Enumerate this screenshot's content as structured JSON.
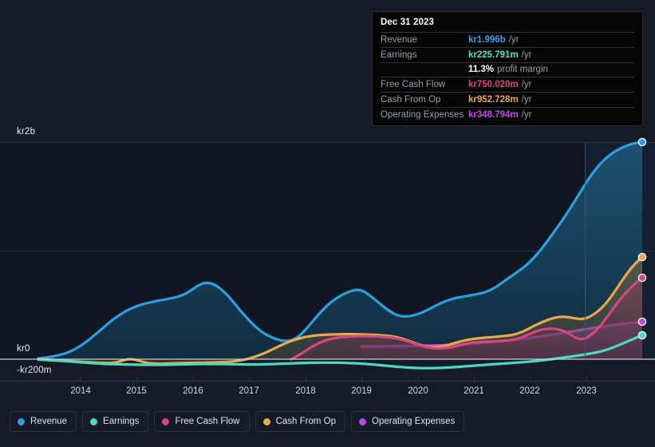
{
  "tooltip": {
    "date": "Dec 31 2023",
    "rows": [
      {
        "label": "Revenue",
        "value": "kr1.996b",
        "unit": "/yr",
        "color": "#3ba3e8"
      },
      {
        "label": "Earnings",
        "value": "kr225.791m",
        "unit": "/yr",
        "color": "#4fe3c8"
      },
      {
        "label": "",
        "value": "11.3%",
        "unit": "profit margin",
        "color": "#ffffff"
      },
      {
        "label": "Free Cash Flow",
        "value": "kr750.020m",
        "unit": "/yr",
        "color": "#e0477f"
      },
      {
        "label": "Cash From Op",
        "value": "kr952.728m",
        "unit": "/yr",
        "color": "#e9a94a"
      },
      {
        "label": "Operating Expenses",
        "value": "kr348.794m",
        "unit": "/yr",
        "color": "#c44ae8"
      }
    ]
  },
  "legend": [
    {
      "label": "Revenue",
      "color": "#2e9fe0"
    },
    {
      "label": "Earnings",
      "color": "#4fd8c0"
    },
    {
      "label": "Free Cash Flow",
      "color": "#d6487e"
    },
    {
      "label": "Cash From Op",
      "color": "#e8a84c"
    },
    {
      "label": "Operating Expenses",
      "color": "#b94ae8"
    }
  ],
  "axes": {
    "y_labels": [
      "kr2b",
      "kr0",
      "-kr200m"
    ],
    "x_labels": [
      "2014",
      "2015",
      "2016",
      "2017",
      "2018",
      "2019",
      "2020",
      "2021",
      "2022",
      "2023"
    ]
  },
  "chart_data": {
    "type": "area",
    "title": "",
    "xlabel": "",
    "ylabel": "",
    "currency": "kr",
    "ylim": [
      -200000000,
      2000000000
    ],
    "yticks": [
      2000000000,
      0,
      -200000000
    ],
    "ytick_labels": [
      "kr2b",
      "kr0",
      "-kr200m"
    ],
    "gridlines": [
      2000000000,
      1000000000,
      0
    ],
    "xlim": [
      "2013-06",
      "2023-12"
    ],
    "xticks": [
      "2014",
      "2015",
      "2016",
      "2017",
      "2018",
      "2019",
      "2020",
      "2021",
      "2022",
      "2023"
    ],
    "legend_position": "bottom",
    "highlight_band_from": "2022-10",
    "series": [
      {
        "name": "Revenue",
        "color": "#2e9fe0",
        "fill": "#16394f",
        "x": [
          "2013-06",
          "2013-12",
          "2014-06",
          "2014-12",
          "2015-06",
          "2015-12",
          "2016-03",
          "2016-06",
          "2016-12",
          "2017-06",
          "2017-12",
          "2018-03",
          "2018-06",
          "2018-12",
          "2019-03",
          "2019-06",
          "2019-12",
          "2020-06",
          "2020-12",
          "2021-06",
          "2021-12",
          "2022-06",
          "2022-12",
          "2023-06",
          "2023-12"
        ],
        "values": [
          8000000,
          20000000,
          80000000,
          300000000,
          480000000,
          620000000,
          700000000,
          680000000,
          560000000,
          420000000,
          400000000,
          460000000,
          560000000,
          640000000,
          700000000,
          660000000,
          620000000,
          560000000,
          640000000,
          700000000,
          760000000,
          980000000,
          1300000000,
          1700000000,
          1996000000
        ]
      },
      {
        "name": "Earnings",
        "color": "#4fd8c0",
        "fill": "#1d4a47",
        "x": [
          "2013-06",
          "2014-06",
          "2015-06",
          "2016-06",
          "2017-06",
          "2018-06",
          "2019-06",
          "2020-06",
          "2021-06",
          "2022-06",
          "2023-06",
          "2023-12"
        ],
        "values": [
          -6000000,
          -20000000,
          -30000000,
          -26000000,
          -30000000,
          -24000000,
          -30000000,
          -40000000,
          -10000000,
          40000000,
          140000000,
          225791000
        ]
      },
      {
        "name": "Free Cash Flow",
        "color": "#d6487e",
        "fill": "#4a2b3b",
        "x": [
          "2017-12",
          "2018-06",
          "2018-12",
          "2019-06",
          "2019-12",
          "2020-06",
          "2020-12",
          "2021-06",
          "2021-12",
          "2022-06",
          "2022-12",
          "2023-06",
          "2023-12"
        ],
        "values": [
          -4000000,
          60000000,
          140000000,
          150000000,
          150000000,
          140000000,
          120000000,
          90000000,
          180000000,
          190000000,
          120000000,
          420000000,
          750020000
        ]
      },
      {
        "name": "Cash From Op",
        "color": "#e8a84c",
        "fill": "#4d4332",
        "x": [
          "2013-06",
          "2014-06",
          "2015-06",
          "2016-03",
          "2016-09",
          "2017-06",
          "2018-06",
          "2018-12",
          "2019-06",
          "2019-12",
          "2020-06",
          "2020-12",
          "2021-06",
          "2021-12",
          "2022-06",
          "2022-12",
          "2023-06",
          "2023-12"
        ],
        "values": [
          -6000000,
          -30000000,
          -40000000,
          -10000000,
          -20000000,
          -16000000,
          80000000,
          170000000,
          185000000,
          170000000,
          150000000,
          190000000,
          230000000,
          230000000,
          240000000,
          330000000,
          560000000,
          952728000
        ]
      },
      {
        "name": "Operating Expenses",
        "color": "#b94ae8",
        "fill": "#3e2a55",
        "x": [
          "2019-03",
          "2019-12",
          "2020-06",
          "2021-06",
          "2021-12",
          "2022-06",
          "2022-12",
          "2023-06",
          "2023-12"
        ],
        "values": [
          60000000,
          60000000,
          62000000,
          70000000,
          90000000,
          120000000,
          170000000,
          230000000,
          348794000
        ]
      }
    ],
    "endpoint_markers": [
      {
        "series": "Revenue",
        "value": 1996000000
      },
      {
        "series": "Cash From Op",
        "value": 952728000
      },
      {
        "series": "Free Cash Flow",
        "value": 750020000
      },
      {
        "series": "Operating Expenses",
        "value": 348794000
      },
      {
        "series": "Earnings",
        "value": 225791000
      }
    ]
  }
}
